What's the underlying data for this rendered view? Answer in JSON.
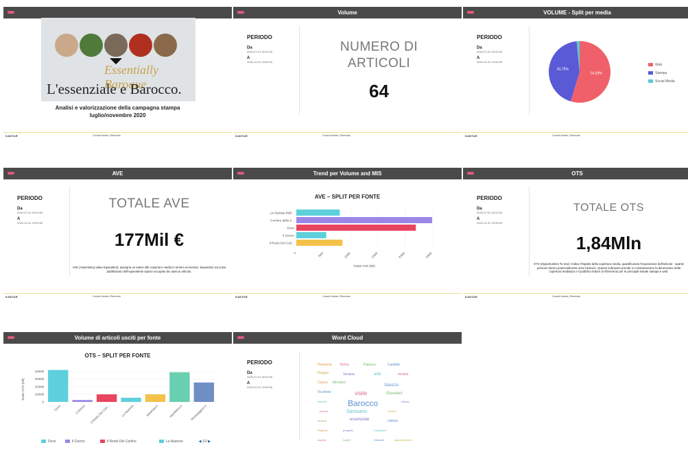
{
  "footer": {
    "brand": "KANTAR",
    "confidential": "Consult Kantar | Riservato"
  },
  "periodo": {
    "title": "PERIODO",
    "da_label": "Da",
    "da_value": "2020-07-01 00:00:00",
    "a_label": "A",
    "a_value": "2020-10-31 23:59:00"
  },
  "cover": {
    "title_main": "L'essenziale e Barocco.",
    "title_overlay": "Essentially Baroque",
    "subtitle_line1": "Analisi e valorizzazione della campagna stampa",
    "subtitle_line2": "luglio/novembre 2020"
  },
  "volume": {
    "header": "Volume",
    "big_title_line1": "NUMERO DI",
    "big_title_line2": "ARTICOLI",
    "value": "64"
  },
  "split_media": {
    "header": "VOLUME - Split per media",
    "chart_data": {
      "type": "pie",
      "slices": [
        {
          "label": "Web",
          "value": 54.69,
          "color": "#f0606a",
          "text": "54,69%"
        },
        {
          "label": "Stampa",
          "value": 43.75,
          "color": "#5a5ad6",
          "text": "43,75%"
        },
        {
          "label": "Social Media",
          "value": 1.56,
          "color": "#5bc8d3",
          "text": ""
        }
      ]
    }
  },
  "ave": {
    "header": "AVE",
    "big_title": "TOTALE AVE",
    "value": "177Mil €",
    "description": "AVE (Advertising Value Equivalent): assegna un valore alle coperture media in termini economici, basandosi sul costo pubblicitario dell'equivalente spazio occupato da ciascun articolo."
  },
  "trend": {
    "header": "Trend per Volume and MIS",
    "chart_data": {
      "type": "bar",
      "title": "AVE – SPLIT PER FONTE",
      "orientation": "horizontal",
      "categories": [
        "La Stampa Biell...",
        "Corriere della S...",
        "Dove",
        "Il Giorno",
        "Il Resto Del Carl..."
      ],
      "values": [
        8,
        25,
        22,
        5.5,
        8.5
      ],
      "colors": [
        "#5ed0dc",
        "#9b86e8",
        "#e84560",
        "#5ed0dc",
        "#f4c24a"
      ],
      "xticks": [
        "0",
        "5Mil",
        "10Mil",
        "15Mil",
        "20Mil",
        "25Mil"
      ],
      "xlim": [
        0,
        25
      ],
      "xlabel": "Totale AVE (Mil)"
    }
  },
  "ots": {
    "header": "OTS",
    "big_title": "TOTALE OTS",
    "value": "1,84Mln",
    "description": "OTS (Opportunities To See): Indica l'impatto della copertura media, quantificando l'esposizione dell'articolo - quante persone hanno potenzialmente visto l'articolo. Questo indicatore prende in considerazione la dimensione della copertura mediatica e il pubblico lettore di riferimento per le principali testate stampa e web."
  },
  "volume_fonte": {
    "header": "Volume di articoli usciti per fonte",
    "chart_data": {
      "type": "bar",
      "title": "OTS – SPLIT PER FONTE",
      "categories": [
        "Dove",
        "Il Giorno",
        "Il Resto Del Carl...",
        "La Nazione",
        "lastampa.it",
        "repubblica.it",
        "ilmessaggero.it"
      ],
      "values": [
        420,
        25,
        100,
        55,
        100,
        390,
        255
      ],
      "colors": [
        "#5ed0dc",
        "#9b86e8",
        "#e84560",
        "#5ed0dc",
        "#f4c24a",
        "#68cfb0",
        "#6f8ec5"
      ],
      "yticks": [
        "0",
        "100Mil",
        "200Mil",
        "300Mil",
        "400Mil"
      ],
      "ylim": [
        0,
        450
      ],
      "ylabel": "Totale OTS (Mil)",
      "legend": [
        {
          "label": "Dove",
          "color": "#5ed0dc"
        },
        {
          "label": "Il Giorno",
          "color": "#9b86e8"
        },
        {
          "label": "Il Resto Del Carlino",
          "color": "#e84560"
        },
        {
          "label": "La Nazione",
          "color": "#5ed0dc"
        }
      ],
      "pager": "1/2"
    }
  },
  "wordcloud": {
    "header": "Word Cloud",
    "words": [
      {
        "text": "Barocco",
        "size": 12,
        "color": "#5a8fd0"
      },
      {
        "text": "visite",
        "size": 8,
        "color": "#d86a8a"
      },
      {
        "text": "Giovanni",
        "size": 6,
        "color": "#7ab86a"
      },
      {
        "text": "Santuario",
        "size": 7,
        "color": "#5ec0c8"
      },
      {
        "text": "essenziale",
        "size": 6,
        "color": "#8a70c8"
      },
      {
        "text": "Saluzzo",
        "size": 6,
        "color": "#5a8fd0"
      },
      {
        "text": "Piemonte",
        "size": 5,
        "color": "#e09a4a"
      },
      {
        "text": "Torino",
        "size": 5,
        "color": "#d86a8a"
      },
      {
        "text": "Palazzo",
        "size": 5,
        "color": "#7ab86a"
      },
      {
        "text": "Castello",
        "size": 5,
        "color": "#5a8fd0"
      },
      {
        "text": "Reggia",
        "size": 5,
        "color": "#c8b24a"
      },
      {
        "text": "Venaria",
        "size": 5,
        "color": "#8a70c8"
      },
      {
        "text": "arte",
        "size": 6,
        "color": "#5ec0c8"
      },
      {
        "text": "mostra",
        "size": 5,
        "color": "#d86a8a"
      },
      {
        "text": "Cuneo",
        "size": 5,
        "color": "#e09a4a"
      },
      {
        "text": "Mondovì",
        "size": 5,
        "color": "#7ab86a"
      },
      {
        "text": "Vicoforte",
        "size": 5,
        "color": "#5a8fd0"
      },
      {
        "text": "chiese",
        "size": 4,
        "color": "#8a70c8"
      },
      {
        "text": "itinerari",
        "size": 4,
        "color": "#5ec0c8"
      },
      {
        "text": "Juvarra",
        "size": 4,
        "color": "#d86a8a"
      },
      {
        "text": "Guarini",
        "size": 4,
        "color": "#c8b24a"
      },
      {
        "text": "turismo",
        "size": 4,
        "color": "#7ab86a"
      },
      {
        "text": "cultura",
        "size": 5,
        "color": "#5a8fd0"
      },
      {
        "text": "Regione",
        "size": 4,
        "color": "#e09a4a"
      },
      {
        "text": "progetto",
        "size": 4,
        "color": "#8a70c8"
      },
      {
        "text": "Carignano",
        "size": 4,
        "color": "#5ec0c8"
      },
      {
        "text": "cupola",
        "size": 4,
        "color": "#d86a8a"
      },
      {
        "text": "luoghi",
        "size": 4,
        "color": "#7ab86a"
      },
      {
        "text": "Sabaudi",
        "size": 4,
        "color": "#5a8fd0"
      },
      {
        "text": "appuntamento",
        "size": 4,
        "color": "#c8b24a"
      }
    ]
  }
}
